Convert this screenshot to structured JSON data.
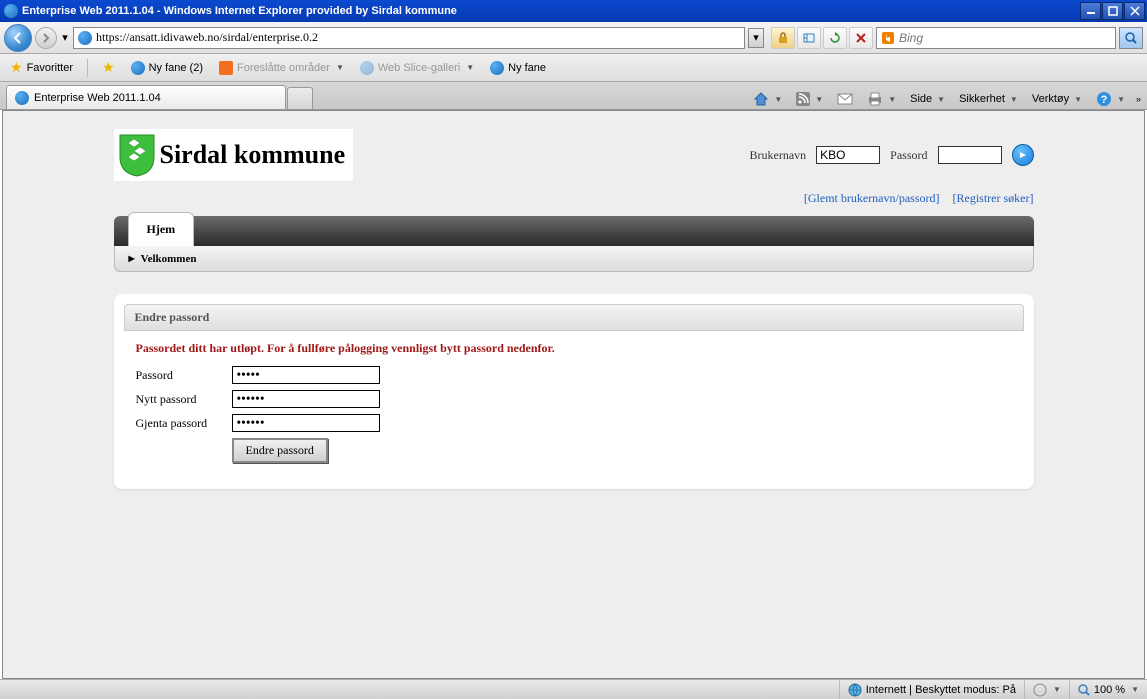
{
  "window": {
    "title": "Enterprise Web 2011.1.04 - Windows Internet Explorer provided by Sirdal kommune"
  },
  "address": {
    "url": "https://ansatt.idivaweb.no/sirdal/enterprise.0.2"
  },
  "search": {
    "placeholder": "Bing"
  },
  "favbar": {
    "favoritter": "Favoritter",
    "nyfane": "Ny fane (2)",
    "foreslatte": "Foreslåtte områder",
    "webslice": "Web Slice-galleri",
    "nyfane2": "Ny fane"
  },
  "tab": {
    "title": "Enterprise Web 2011.1.04"
  },
  "cmds": {
    "side": "Side",
    "sikkerhet": "Sikkerhet",
    "verktoy": "Verktøy"
  },
  "brand": {
    "name": "Sirdal kommune"
  },
  "login": {
    "user_label": "Brukernavn",
    "user_value": "KBO",
    "pass_label": "Passord",
    "forgot": "[Glemt brukernavn/passord]",
    "register": "[Registrer søker]"
  },
  "nav": {
    "hjem": "Hjem",
    "velkommen": "Velkommen"
  },
  "panel": {
    "title": "Endre passord",
    "error": "Passordet ditt har utløpt. For å fullføre pålogging vennligst bytt passord nedenfor.",
    "passord_label": "Passord",
    "passord_value": "•••••",
    "nytt_label": "Nytt passord",
    "nytt_value": "••••••",
    "gjenta_label": "Gjenta passord",
    "gjenta_value": "••••••",
    "submit": "Endre passord"
  },
  "status": {
    "zone": "Internett | Beskyttet modus: På",
    "zoom": "100 %"
  }
}
